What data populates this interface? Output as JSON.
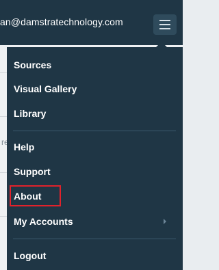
{
  "header": {
    "user_email": "an@damstratechnology.com",
    "menu_icon": "hamburger-menu-icon"
  },
  "background": {
    "partial_text": "re"
  },
  "menu": {
    "sources": "Sources",
    "visual_gallery": "Visual Gallery",
    "library": "Library",
    "help": "Help",
    "support": "Support",
    "about": "About",
    "my_accounts": "My Accounts",
    "logout": "Logout",
    "highlight_color": "#e1222b"
  }
}
